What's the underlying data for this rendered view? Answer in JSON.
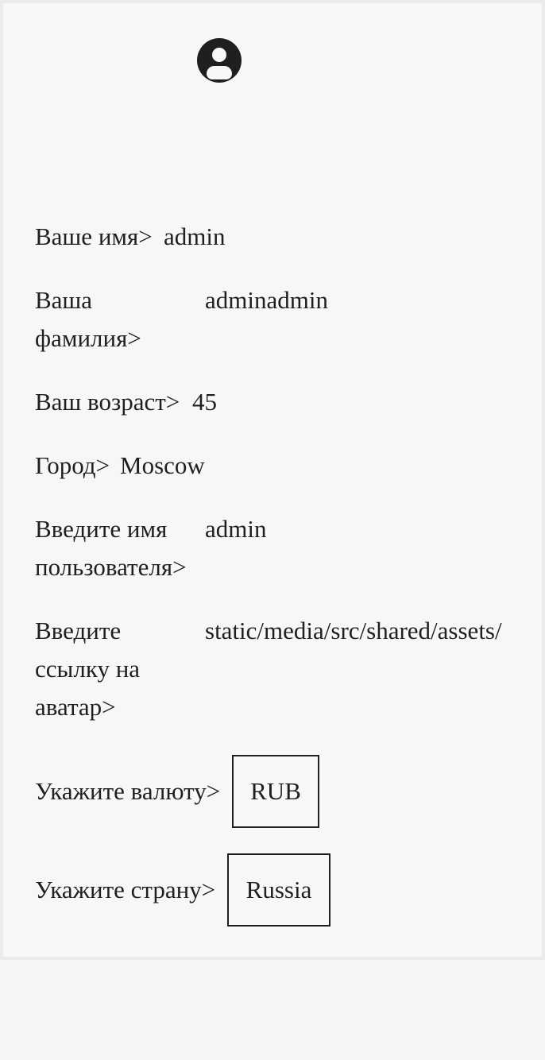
{
  "profile": {
    "avatar_icon": "user-avatar-icon",
    "fields": {
      "first_name": {
        "label": "Ваше имя>",
        "value": "admin"
      },
      "last_name": {
        "label_line1": "Ваша",
        "label_line2": "фамилия>",
        "value": "adminadmin"
      },
      "age": {
        "label": "Ваш возраст>",
        "value": "45"
      },
      "city": {
        "label": "Город>",
        "value": "Moscow"
      },
      "username": {
        "label_line1": "Введите имя",
        "label_line2": "пользователя>",
        "value": "admin"
      },
      "avatar_link": {
        "label_line1": "Введите",
        "label_line2": "ссылку на",
        "label_line3": "аватар>",
        "value": "static/media/src/shared/assets/"
      },
      "currency": {
        "label": "Укажите валюту>",
        "value": "RUB"
      },
      "country": {
        "label": "Укажите страну>",
        "value": "Russia"
      }
    }
  },
  "colors": {
    "background": "#f6f6f6",
    "card_border": "#ebebeb",
    "text": "#1f1f1f"
  }
}
